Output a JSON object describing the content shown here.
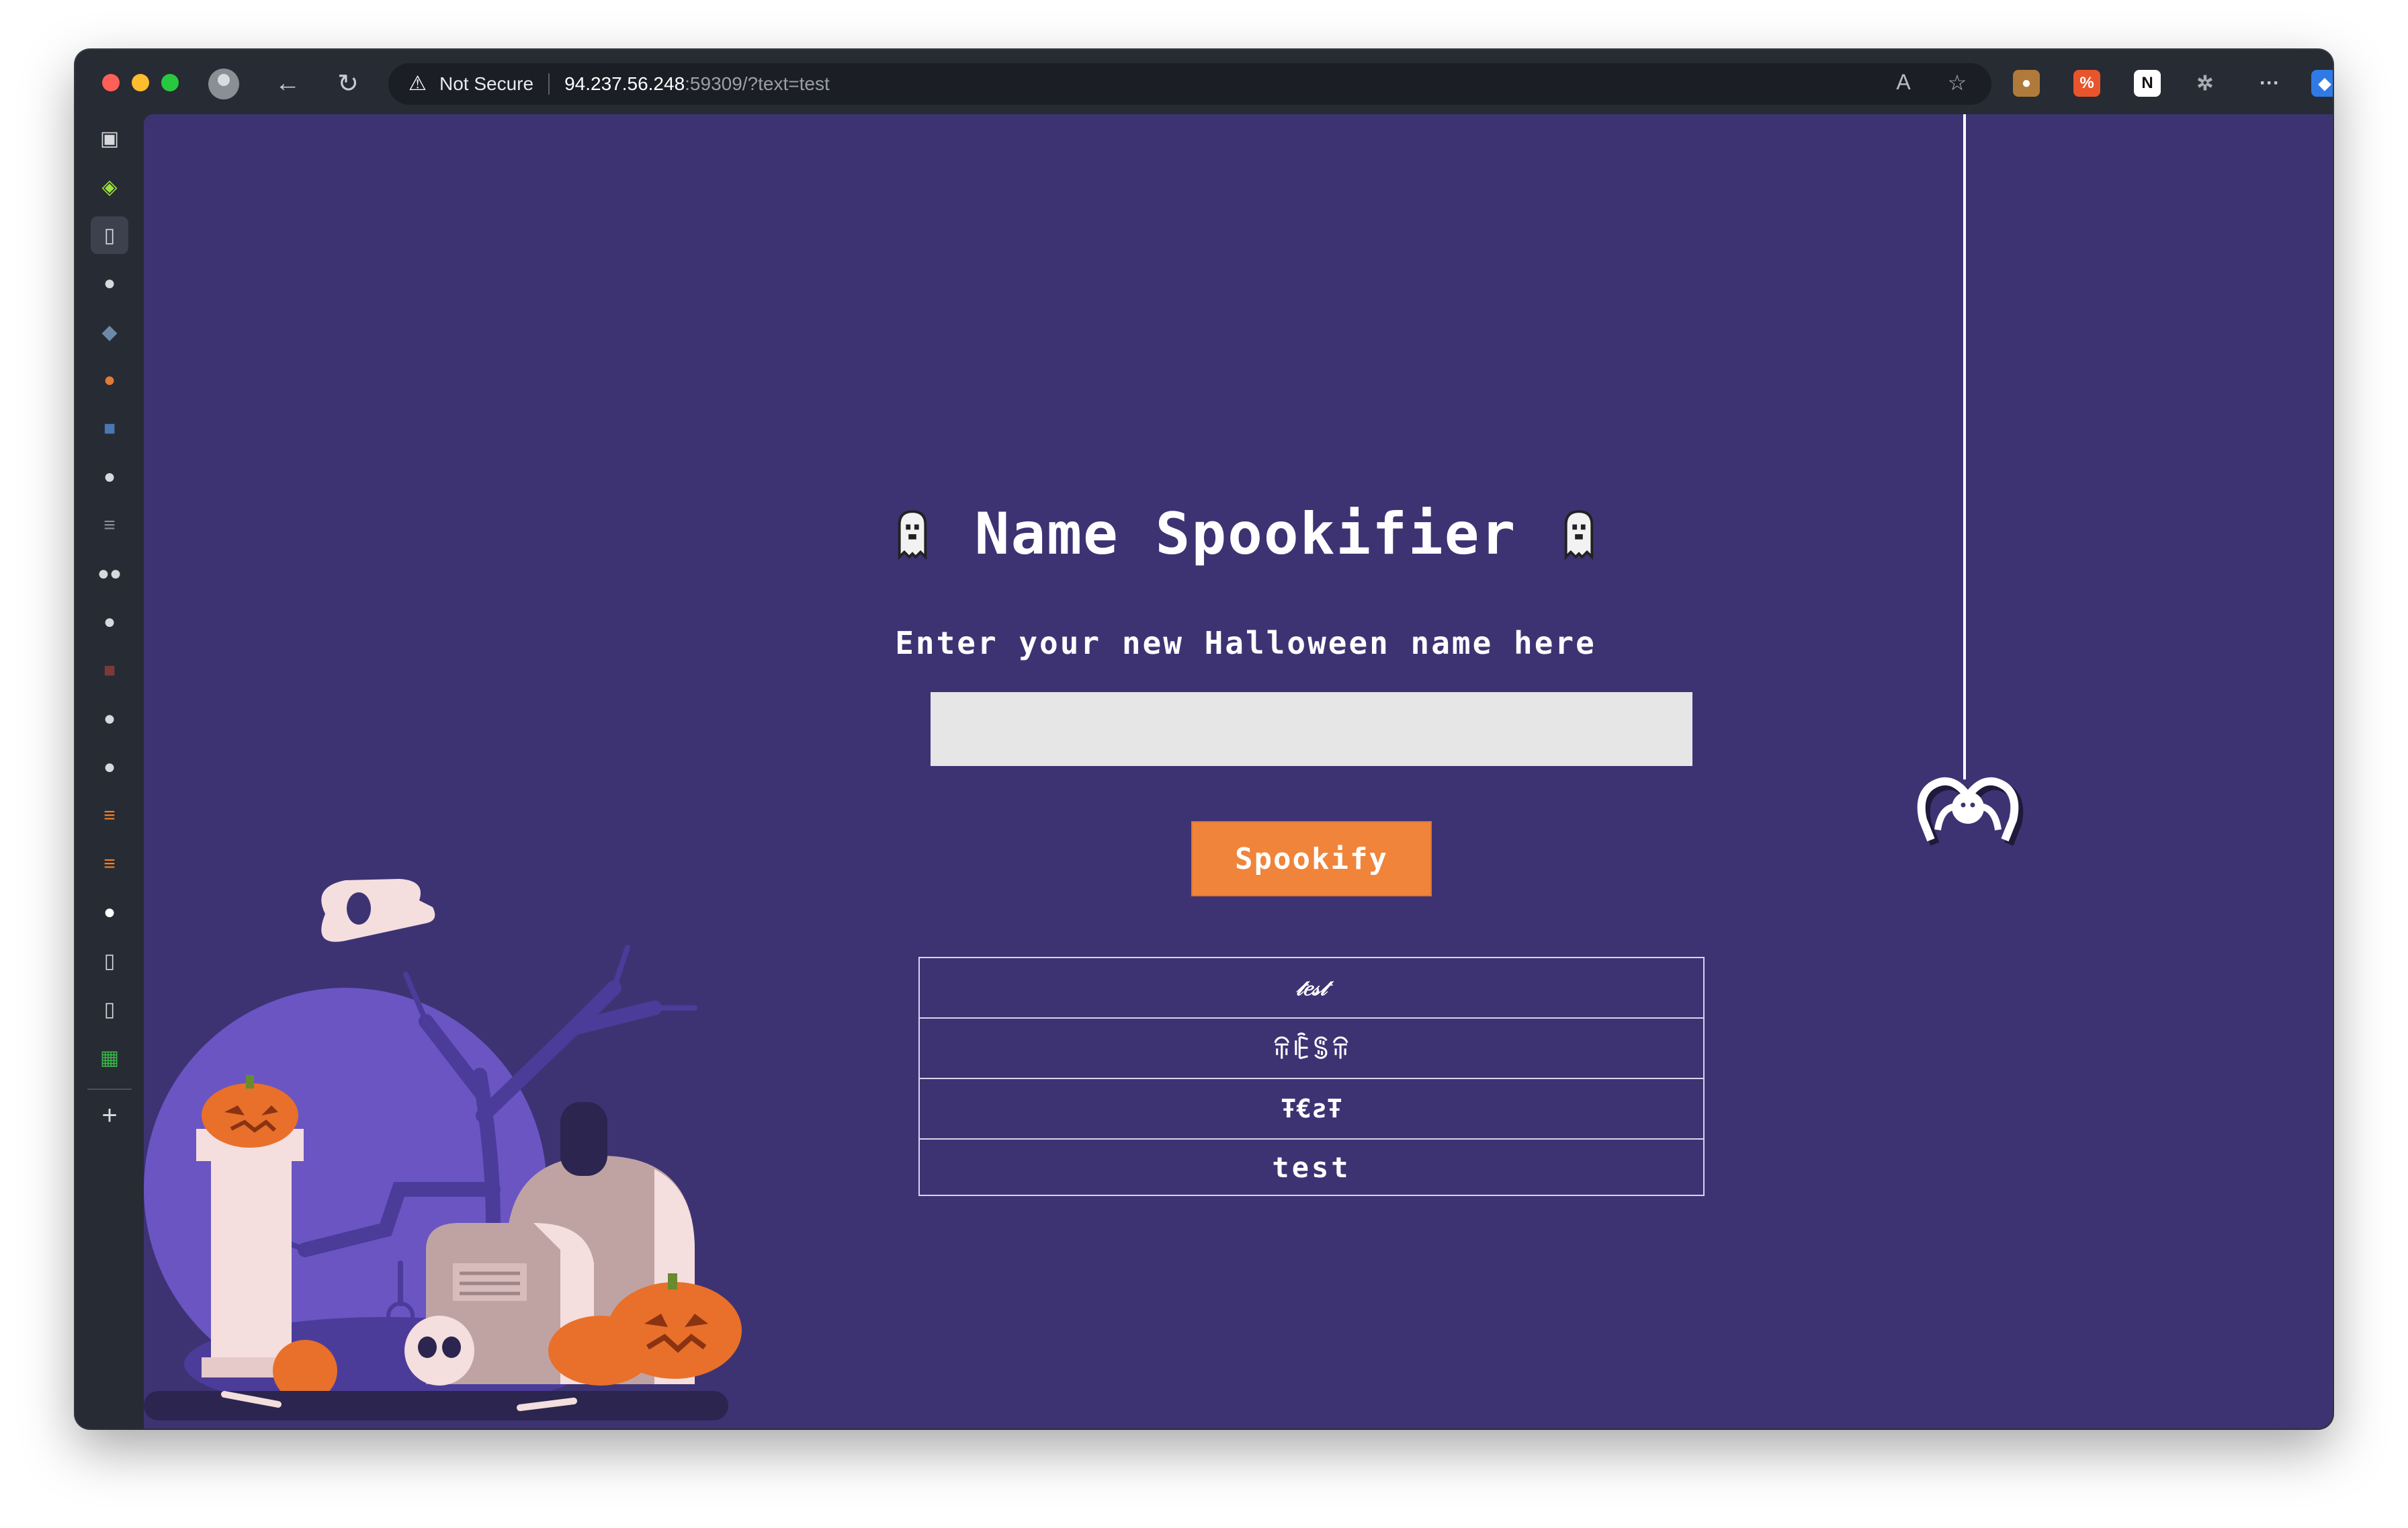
{
  "browser": {
    "security_label": "Not Secure",
    "url_host": "94.237.56.248",
    "url_rest": ":59309/?text=test",
    "icons": [
      "warning-icon",
      "read-aloud-icon",
      "favorite-star-icon",
      "cookie-extension-icon",
      "extension-icon",
      "notion-icon",
      "extensions-puzzle-icon",
      "more-icon",
      "copilot-icon"
    ]
  },
  "sidebar": {
    "items": [
      "tab-actions",
      "extension",
      "page",
      "github",
      "shield",
      "fox",
      "puzzle",
      "github",
      "stack",
      "medium",
      "github",
      "game",
      "github",
      "github",
      "stack",
      "stack",
      "github",
      "page",
      "page",
      "sheets"
    ],
    "add_label": "+"
  },
  "page": {
    "title": "Name Spookifier",
    "subtitle": "Enter your new Halloween name here",
    "input_value": "",
    "button_label": "Spookify",
    "results": [
      "𝓉𝑒𝓈𝓉",
      "ꋖꍟꌚꋖ",
      "Ŧ€ƨŦ",
      "test"
    ]
  },
  "colors": {
    "page_bg": "#3d3373",
    "button": "#f0843a",
    "input_bg": "#e6e6e6"
  }
}
